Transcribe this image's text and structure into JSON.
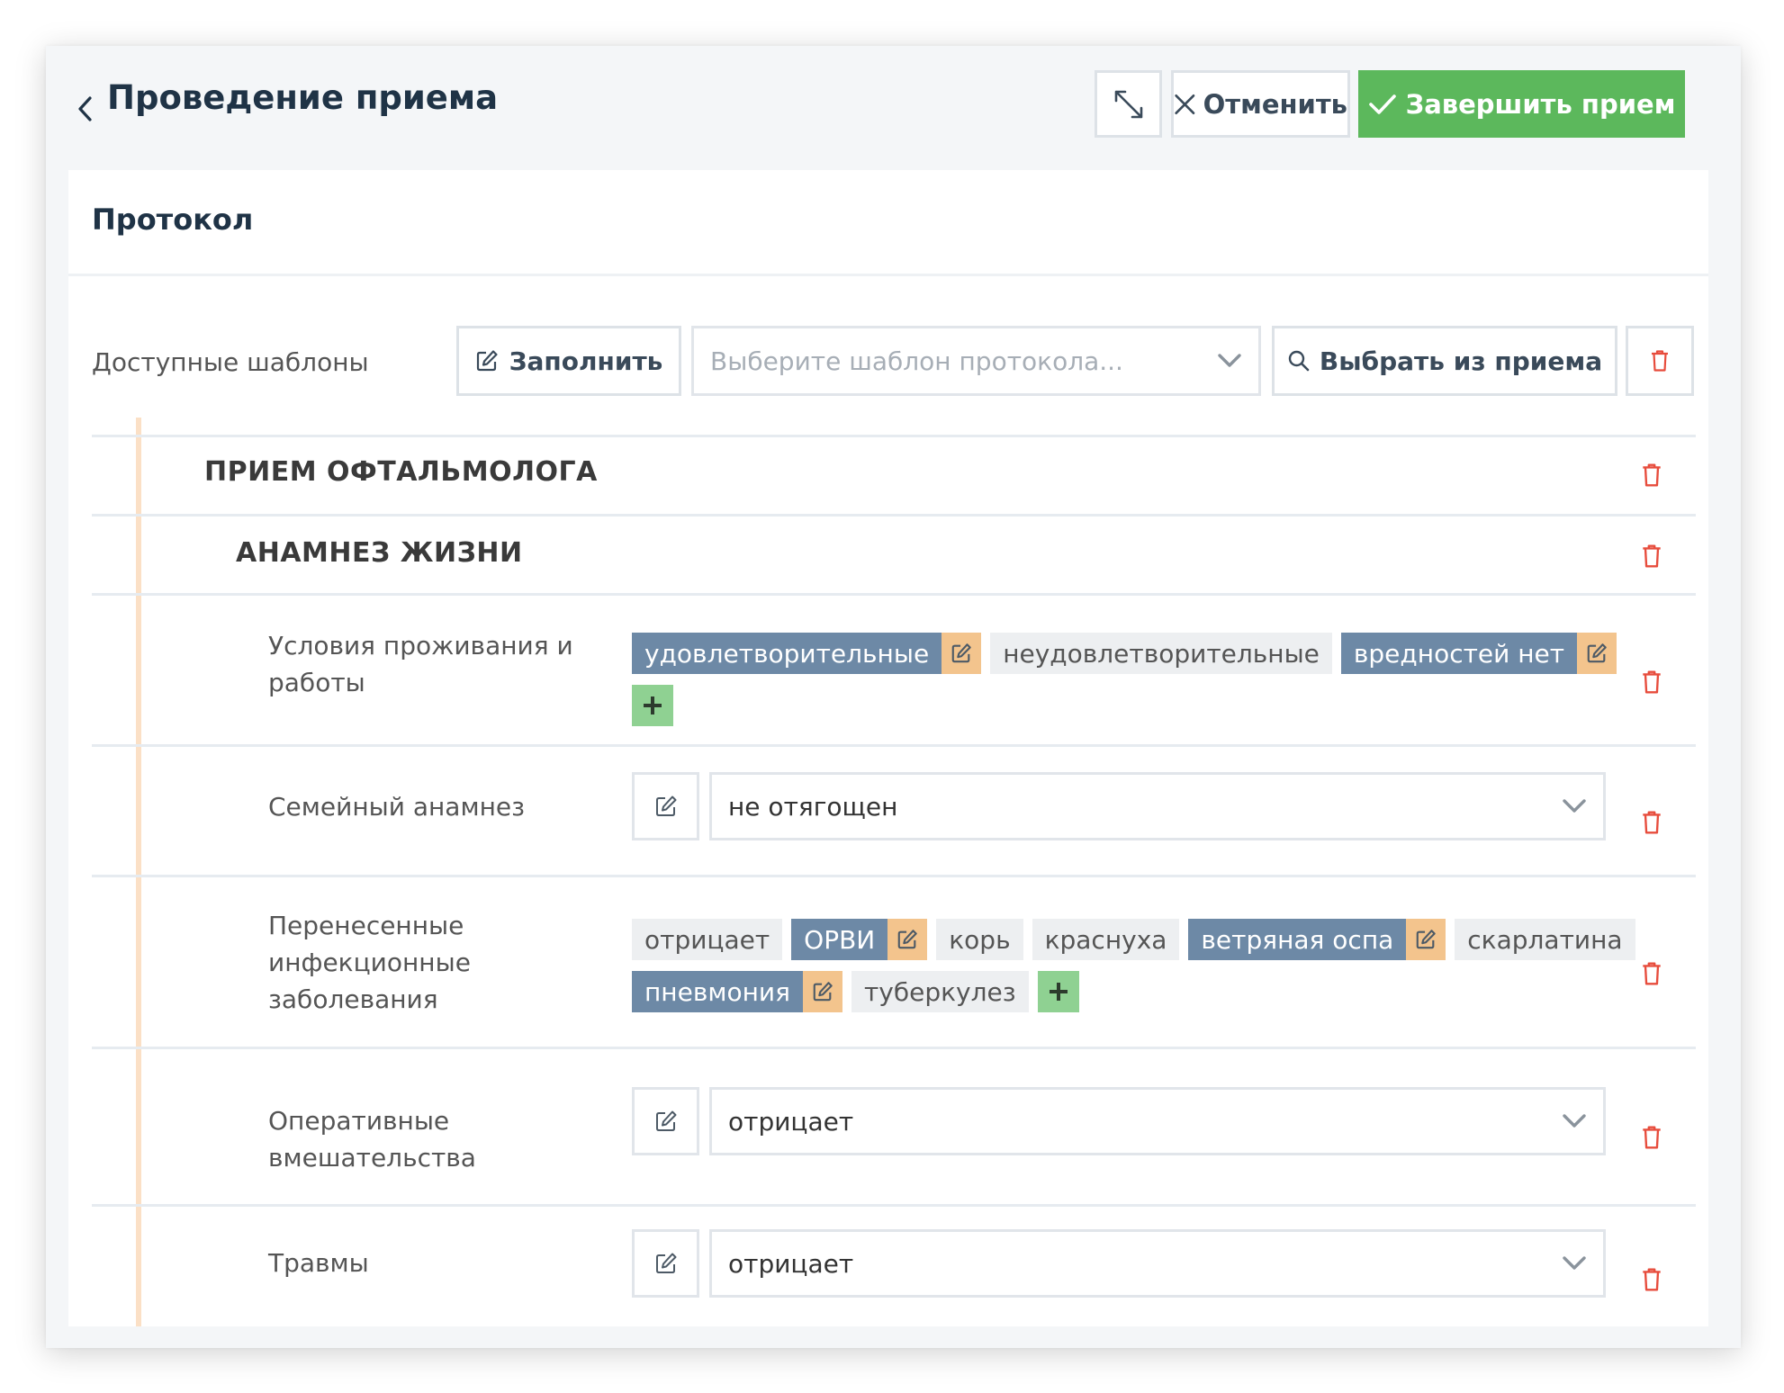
{
  "header": {
    "title": "Проведение приема",
    "cancel_label": "Отменить",
    "finish_label": "Завершить прием"
  },
  "panel": {
    "title": "Протокол"
  },
  "templates": {
    "label": "Доступные шаблоны",
    "fill_label": "Заполнить",
    "select_placeholder": "Выберите шаблон протокола...",
    "pick_label": "Выбрать из приема"
  },
  "sections": {
    "main": "ПРИЕМ ОФТАЛЬМОЛОГА",
    "sub": "АНАМНЕЗ ЖИЗНИ"
  },
  "fields": {
    "living": {
      "label": "Условия проживания и работы",
      "tags": [
        {
          "text": "удовлетворительные",
          "selected": true
        },
        {
          "text": "неудовлетворительные",
          "selected": false
        },
        {
          "text": "вредностей нет",
          "selected": true
        }
      ]
    },
    "family": {
      "label": "Семейный анамнез",
      "value": "не отягощен"
    },
    "infections": {
      "label": "Перенесенные инфекционные заболевания",
      "tags": [
        {
          "text": "отрицает",
          "selected": false
        },
        {
          "text": "ОРВИ",
          "selected": true
        },
        {
          "text": "корь",
          "selected": false
        },
        {
          "text": "краснуха",
          "selected": false
        },
        {
          "text": "ветряная оспа",
          "selected": true
        },
        {
          "text": "скарлатина",
          "selected": false
        },
        {
          "text": "пневмония",
          "selected": true
        },
        {
          "text": "туберкулез",
          "selected": false
        }
      ]
    },
    "surgery": {
      "label": "Оперативные вмешательства",
      "value": "отрицает"
    },
    "injuries": {
      "label": "Травмы",
      "value": "отрицает"
    }
  },
  "colors": {
    "accent_green": "#5cb85c",
    "tag_selected": "#6d89a6",
    "tag_edit": "#f3c48d",
    "tag_add": "#8fd192",
    "trash_red": "#e74c3c",
    "title_navy": "#1f3346"
  },
  "icons": {
    "back": "chevron-left-icon",
    "expand": "expand-icon",
    "cancel": "close-icon",
    "finish": "check-icon",
    "fill": "edit-icon",
    "search": "search-icon",
    "delete": "trash-icon",
    "dropdown": "chevron-down-icon",
    "add": "plus-icon"
  }
}
